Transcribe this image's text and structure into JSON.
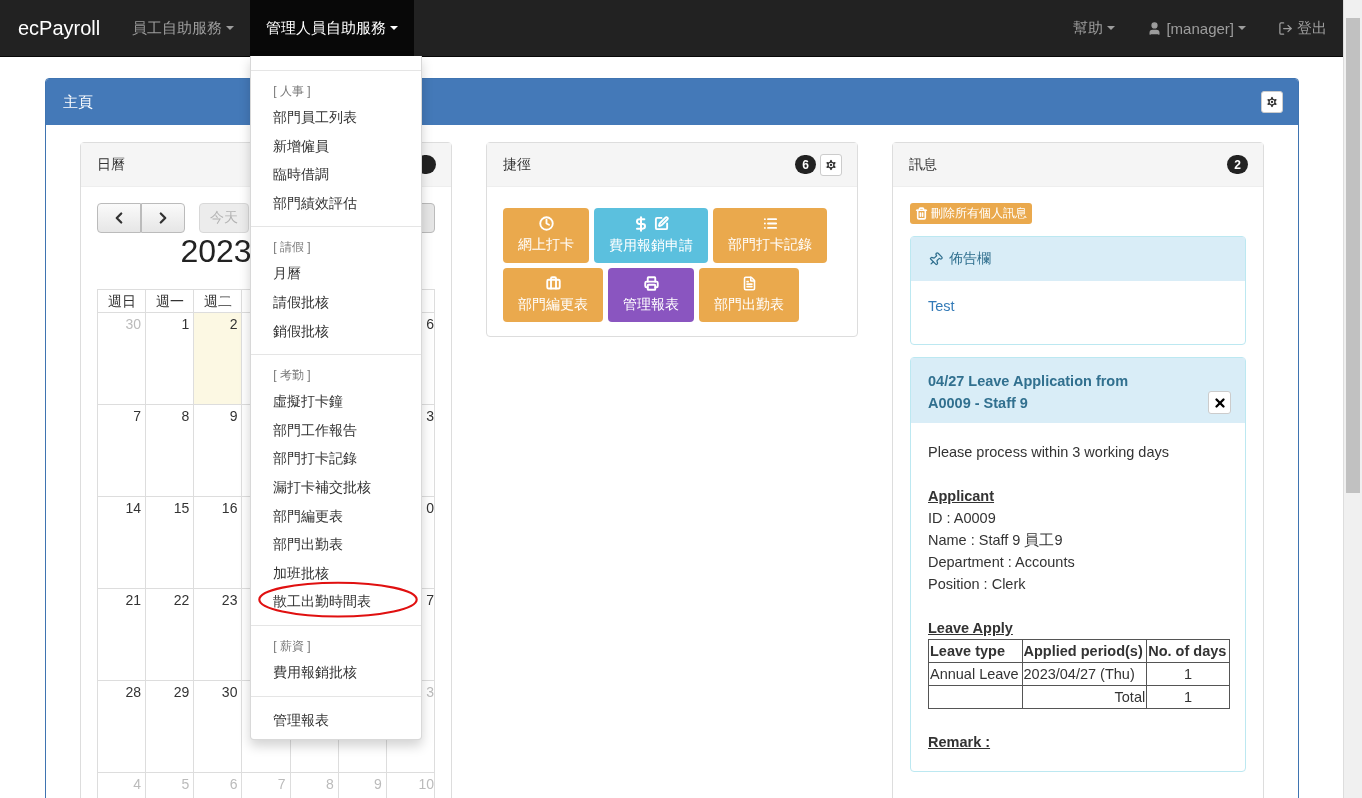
{
  "navbar": {
    "brand": "ecPayroll",
    "menus": [
      {
        "label": "員工自助服務",
        "selected": false
      },
      {
        "label": "管理人員自助服務",
        "selected": true
      }
    ],
    "right": [
      {
        "kind": "dropdown",
        "label": "幫助"
      },
      {
        "kind": "user",
        "label": "[manager]"
      },
      {
        "kind": "logout",
        "label": "登出"
      }
    ]
  },
  "dropdown": {
    "items": [
      {
        "kind": "divider"
      },
      {
        "kind": "header",
        "label": "[ 人事 ]"
      },
      {
        "kind": "item",
        "label": "部門員工列表",
        "circled": false
      },
      {
        "kind": "item",
        "label": "新增僱員",
        "circled": false
      },
      {
        "kind": "item",
        "label": "臨時借調",
        "circled": false
      },
      {
        "kind": "item",
        "label": "部門績效評估",
        "circled": false
      },
      {
        "kind": "divider"
      },
      {
        "kind": "header",
        "label": "[ 請假 ]"
      },
      {
        "kind": "item",
        "label": "月曆",
        "circled": false
      },
      {
        "kind": "item",
        "label": "請假批核",
        "circled": false
      },
      {
        "kind": "item",
        "label": "銷假批核",
        "circled": false
      },
      {
        "kind": "divider"
      },
      {
        "kind": "header",
        "label": "[ 考勤 ]"
      },
      {
        "kind": "item",
        "label": "虛擬打卡鐘",
        "circled": false
      },
      {
        "kind": "item",
        "label": "部門工作報告",
        "circled": false
      },
      {
        "kind": "item",
        "label": "部門打卡記錄",
        "circled": false
      },
      {
        "kind": "item",
        "label": "漏打卡補交批核",
        "circled": false
      },
      {
        "kind": "item",
        "label": "部門編更表",
        "circled": false
      },
      {
        "kind": "item",
        "label": "部門出勤表",
        "circled": false
      },
      {
        "kind": "item",
        "label": "加班批核",
        "circled": false
      },
      {
        "kind": "item",
        "label": "散工出勤時間表",
        "circled": true
      },
      {
        "kind": "divider"
      },
      {
        "kind": "header",
        "label": "[ 薪資 ]"
      },
      {
        "kind": "item",
        "label": "費用報銷批核",
        "circled": false
      },
      {
        "kind": "divider"
      },
      {
        "kind": "item",
        "label": "管理報表",
        "circled": false
      }
    ]
  },
  "main_panel": {
    "title": "主頁"
  },
  "calendar": {
    "title": "日曆",
    "today_button": {
      "label": "今天",
      "disabled": true
    },
    "heading": "2023",
    "weekdays": [
      "週日",
      "週一",
      "週二"
    ],
    "rows": [
      [
        {
          "day": "30",
          "other_month": true,
          "today": false
        },
        {
          "day": "1",
          "other_month": false,
          "today": false
        },
        {
          "day": "2",
          "other_month": false,
          "today": true
        },
        null,
        null,
        null,
        {
          "day": "6",
          "other_month": false,
          "today": false
        }
      ],
      [
        {
          "day": "7",
          "other_month": false,
          "today": false
        },
        {
          "day": "8",
          "other_month": false,
          "today": false
        },
        {
          "day": "9",
          "other_month": false,
          "today": false
        },
        null,
        null,
        null,
        {
          "day": "3",
          "other_month": false,
          "today": false
        }
      ],
      [
        {
          "day": "14",
          "other_month": false,
          "today": false
        },
        {
          "day": "15",
          "other_month": false,
          "today": false
        },
        {
          "day": "16",
          "other_month": false,
          "today": false
        },
        null,
        null,
        null,
        {
          "day": "0",
          "other_month": false,
          "today": false
        }
      ],
      [
        {
          "day": "21",
          "other_month": false,
          "today": false
        },
        {
          "day": "22",
          "other_month": false,
          "today": false
        },
        {
          "day": "23",
          "other_month": false,
          "today": false
        },
        null,
        null,
        null,
        {
          "day": "7",
          "other_month": false,
          "today": false
        }
      ],
      [
        {
          "day": "28",
          "other_month": false,
          "today": false
        },
        {
          "day": "29",
          "other_month": false,
          "today": false
        },
        {
          "day": "30",
          "other_month": false,
          "today": false
        },
        null,
        null,
        null,
        {
          "day": "3",
          "other_month": true,
          "today": false
        }
      ],
      [
        {
          "day": "4",
          "other_month": true,
          "today": false
        },
        {
          "day": "5",
          "other_month": true,
          "today": false
        },
        {
          "day": "6",
          "other_month": true,
          "today": false
        },
        {
          "day": "7",
          "other_month": true,
          "today": false
        },
        {
          "day": "8",
          "other_month": true,
          "today": false
        },
        {
          "day": "9",
          "other_month": true,
          "today": false
        },
        {
          "day": "10",
          "other_month": true,
          "today": false
        }
      ]
    ]
  },
  "shortcuts": {
    "title": "捷徑",
    "count": "6",
    "buttons": [
      {
        "label": "網上打卡",
        "color": "#eaa94d"
      },
      {
        "label": "費用報銷申請",
        "color": "#5bc0de"
      },
      {
        "label": "部門打卡記錄",
        "color": "#eaa94d"
      },
      {
        "label": "部門編更表",
        "color": "#eaa94d"
      },
      {
        "label": "管理報表",
        "color": "#8a55c0"
      },
      {
        "label": "部門出勤表",
        "color": "#eaa94d"
      }
    ]
  },
  "messages": {
    "title": "訊息",
    "count": "2",
    "delete_button": "刪除所有個人訊息",
    "bulletin": {
      "title": "佈告欄",
      "body": "Test"
    },
    "leave_message": {
      "title": "04/27 Leave Application from A0009 - Staff 9",
      "intro": "Please process within 3 working days",
      "applicant": {
        "heading": "Applicant",
        "lines": [
          "ID : A0009",
          "Name : Staff 9 員工9",
          "Department : Accounts",
          "Position : Clerk"
        ]
      },
      "leave": {
        "heading": "Leave Apply",
        "columns": [
          "Leave type",
          "Applied period(s)",
          "No. of days"
        ],
        "rows": [
          [
            "Annual Leave",
            "2023/04/27 (Thu)",
            "1"
          ]
        ],
        "total": {
          "label": "Total",
          "value": "1"
        }
      },
      "remark": "Remark :"
    }
  }
}
